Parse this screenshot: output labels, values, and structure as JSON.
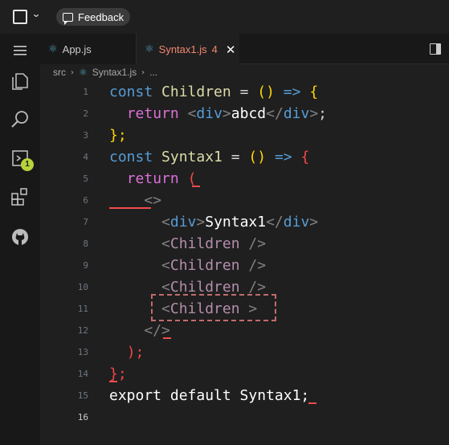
{
  "titlebar": {
    "feedback_label": "Feedback"
  },
  "activity_bar": {
    "items": [
      "menu-icon",
      "explorer-icon",
      "search-icon",
      "run-debug-icon",
      "extensions-icon",
      "github-icon"
    ],
    "badge": "1"
  },
  "tabs": [
    {
      "label": "App.js",
      "icon": "react-icon",
      "active": false
    },
    {
      "label": "Syntax1.js",
      "icon": "react-icon",
      "active": true,
      "problems": "4",
      "close": "✕"
    }
  ],
  "breadcrumb": {
    "folder": "src",
    "file": "Syntax1.js",
    "more": "..."
  },
  "editor": {
    "lines": [
      {
        "n": "1"
      },
      {
        "n": "2"
      },
      {
        "n": "3"
      },
      {
        "n": "4"
      },
      {
        "n": "5"
      },
      {
        "n": "6"
      },
      {
        "n": "7"
      },
      {
        "n": "8"
      },
      {
        "n": "9"
      },
      {
        "n": "10"
      },
      {
        "n": "11"
      },
      {
        "n": "12"
      },
      {
        "n": "13"
      },
      {
        "n": "14"
      },
      {
        "n": "15"
      },
      {
        "n": "16"
      }
    ],
    "tokens": {
      "l1": [
        "const",
        "Children",
        "=",
        "()",
        "=>",
        "{"
      ],
      "l2": [
        "return",
        "<",
        "div",
        ">",
        "abcd",
        "</",
        "div",
        ">",
        ";"
      ],
      "l3": [
        "};"
      ],
      "l4": [
        "const",
        "Syntax1",
        "=",
        "()",
        "=>",
        "{"
      ],
      "l5": [
        "return",
        "("
      ],
      "l6": [
        "<>"
      ],
      "l7": [
        "<",
        "div",
        ">",
        "Syntax1",
        "</",
        "div",
        ">"
      ],
      "l8": [
        "<",
        "Children",
        "/>"
      ],
      "l9": [
        "<",
        "Children",
        "/>"
      ],
      "l10": [
        "<",
        "Children",
        "/>"
      ],
      "l11": [
        "<",
        "Children",
        ">"
      ],
      "l12": [
        "</>"
      ],
      "l13": [
        ");"
      ],
      "l14": [
        "};"
      ],
      "l15": [
        "export default Syntax1",
        ";"
      ]
    }
  }
}
